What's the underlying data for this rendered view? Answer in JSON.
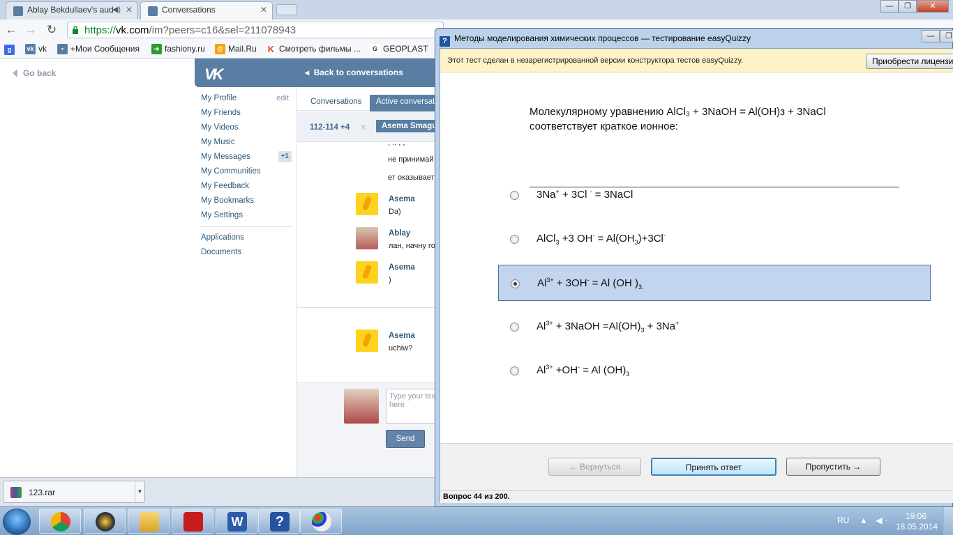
{
  "browser": {
    "tabs": [
      {
        "title": "Ablay Bekdullaev's aud"
      },
      {
        "title": "Conversations"
      }
    ],
    "url": {
      "scheme": "https://",
      "host": "vk.com",
      "path": "/im?peers=c16&sel=211078943"
    },
    "bookmarks": [
      "vk",
      "+Мои Сообщения",
      "fashiony.ru",
      "Mail.Ru",
      "Смотреть фильмы ...",
      "GEOPLAST"
    ],
    "window_buttons": [
      "—",
      "❐",
      "✕"
    ]
  },
  "vk": {
    "go_back": "Go back",
    "back_to_conversations": "Back to conversations",
    "menu": [
      {
        "label": "My Profile",
        "aux": "edit"
      },
      {
        "label": "My Friends"
      },
      {
        "label": "My Videos"
      },
      {
        "label": "My Music"
      },
      {
        "label": "My Messages",
        "badge": "+1"
      },
      {
        "label": "My Communities"
      },
      {
        "label": "My Feedback"
      },
      {
        "label": "My Bookmarks"
      },
      {
        "label": "My Settings"
      }
    ],
    "menu2": [
      "Applications",
      "Documents"
    ],
    "tabs": [
      "Conversations",
      "Active conversations"
    ],
    "peer_ids": "112-114 +4",
    "peer_name": "Asema Smagulova",
    "prev_lines": [
      "не принимай",
      "ет оказывает"
    ],
    "messages": [
      {
        "author": "Asema",
        "text": "Da)"
      },
      {
        "author": "Ablay",
        "text": "лан, начну готовиться"
      },
      {
        "author": "Asema",
        "text": ")"
      },
      {
        "author": "Asema",
        "text": "uchiw?"
      }
    ],
    "input_placeholder": "Type your text here",
    "send": "Send"
  },
  "download": {
    "file": "123.rar"
  },
  "taskbar": {
    "lang": "RU",
    "tray": "▲ ◀ᐧ",
    "time": "19:06",
    "date": "18.05.2014"
  },
  "quiz": {
    "title": "Методы моделирования химических процессов — тестирование easyQuizzy",
    "warning": "Этот тест сделан в незарегистрированной версии конструктора тестов easyQuizzy.",
    "license_button": "Приобрести лицензию",
    "question_line1": "Молекулярному уравнению AlCl₃ + 3NaOH = Al(OH)з + 3NaCl",
    "question_line2": "соответствует краткое ионное:",
    "options": [
      {
        "html": "3Na<sup>+</sup> + 3Cl <sup>-</sup>  = 3NaCl",
        "selected": false
      },
      {
        "html": "AlCl<sub>3</sub> +3 OH<sup>-</sup> = Al(OH<sub>3</sub>)+3Cl<sup>-</sup>",
        "selected": false
      },
      {
        "html": "Al<sup>3+</sup> +  3OH<sup>-</sup> = Al (OH )<sub>3.</sub>",
        "selected": true
      },
      {
        "html": "Al<sup>3+</sup>  + 3NaOH  =Al(OH)<sub>3</sub> + 3Na<sup>+</sup>",
        "selected": false
      },
      {
        "html": "Al<sup>3+</sup> +OH<sup>-</sup> = Al (OH)<sub>3</sub>",
        "selected": false
      }
    ],
    "btn_back": "← Вернуться",
    "btn_accept": "Принять ответ",
    "btn_skip": "Пропустить →",
    "status": "Вопрос 44 из 200."
  }
}
